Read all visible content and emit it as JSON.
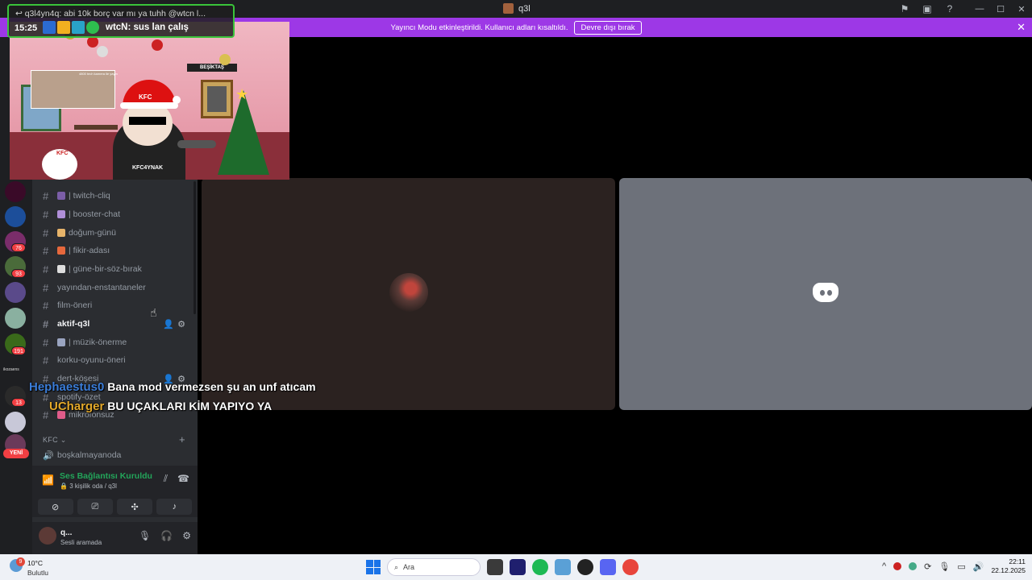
{
  "window": {
    "title": "q3l"
  },
  "banner": {
    "message": "Yayıncı Modu etkinleştirildi. Kullanıcı adları kısaltıldı.",
    "button": "Devre dışı bırak"
  },
  "guilds": {
    "badges": [
      "76",
      "93",
      "191",
      "13"
    ],
    "new_label": "YENİ",
    "folder_label": "ikozaens"
  },
  "channels": [
    {
      "name": "| twitch-cliq"
    },
    {
      "name": "| booster-chat"
    },
    {
      "name": "doğum-günü"
    },
    {
      "name": "| fikir-adası"
    },
    {
      "name": "| güne-bir-söz-bırak"
    },
    {
      "name": "yayından-enstantaneler"
    },
    {
      "name": "film-öneri"
    },
    {
      "name": "aktif-q3l"
    },
    {
      "name": "| müzik-önerme"
    },
    {
      "name": "korku-oyunu-öneri"
    },
    {
      "name": "dert-köşesi"
    },
    {
      "name": "spotify-özet"
    },
    {
      "name": "mikrofonsuz"
    }
  ],
  "category": {
    "label": "KFC",
    "voice_channel": "boşkalmayanoda"
  },
  "voice": {
    "status": "Ses Bağlantısı Kuruldu",
    "room": "3 kişilik oda / q3l"
  },
  "user": {
    "name": "q...",
    "status": "Sesli aramada"
  },
  "stream_chat": {
    "reply": "q3l4yn4q: abi 10k borç var mı ya tuhh @wtcn l...",
    "time": "15:25",
    "author": "wtcN:",
    "message": "sus lan çalış"
  },
  "stream_scene": {
    "hat_text": "KFC",
    "sign_text": "BEŞİKTAŞ",
    "photo_caption": "4800 tech kamera ile yayın",
    "snowman_text": "KFC",
    "shirt_text": "KFC4YNAK"
  },
  "overlay_chat": [
    {
      "user": "Hephaestus0",
      "text": "Bana mod vermezsen şu an unf atıcam"
    },
    {
      "user": "UCharger",
      "text": "BU UÇAKLARI KİM YAPIYO YA"
    }
  ],
  "taskbar": {
    "weather_count": "9",
    "temp": "10°C",
    "condition": "Bulutlu",
    "search": "Ara",
    "time": "22:11",
    "date": "22.12.2025"
  },
  "colors": {
    "banner": "#9d38e6",
    "connected": "#23a55a",
    "badge": "#f23f43",
    "chat_border": "#3ac43a"
  }
}
